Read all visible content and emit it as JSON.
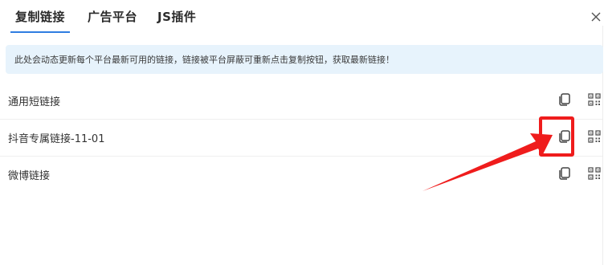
{
  "tabs": [
    {
      "label": "复制链接",
      "active": true
    },
    {
      "label": "广告平台",
      "active": false
    },
    {
      "label": "JS插件",
      "active": false
    }
  ],
  "close_icon": "close-icon",
  "notice": {
    "text": "此处会动态更新每个平台最新可用的链接，链接被平台屏蔽可重新点击复制按钮，获取最新链接！"
  },
  "links": [
    {
      "label": "通用短链接",
      "copy_icon": "copy-icon",
      "qr_icon": "qr-code-icon"
    },
    {
      "label": "抖音专属链接-11-01",
      "copy_icon": "copy-icon",
      "qr_icon": "qr-code-icon"
    },
    {
      "label": "微博链接",
      "copy_icon": "copy-icon",
      "qr_icon": "qr-code-icon"
    }
  ],
  "colors": {
    "accent": "#2f7de1",
    "notice_bg": "#e7f3fc",
    "annotation_red": "#ef1c1c"
  }
}
